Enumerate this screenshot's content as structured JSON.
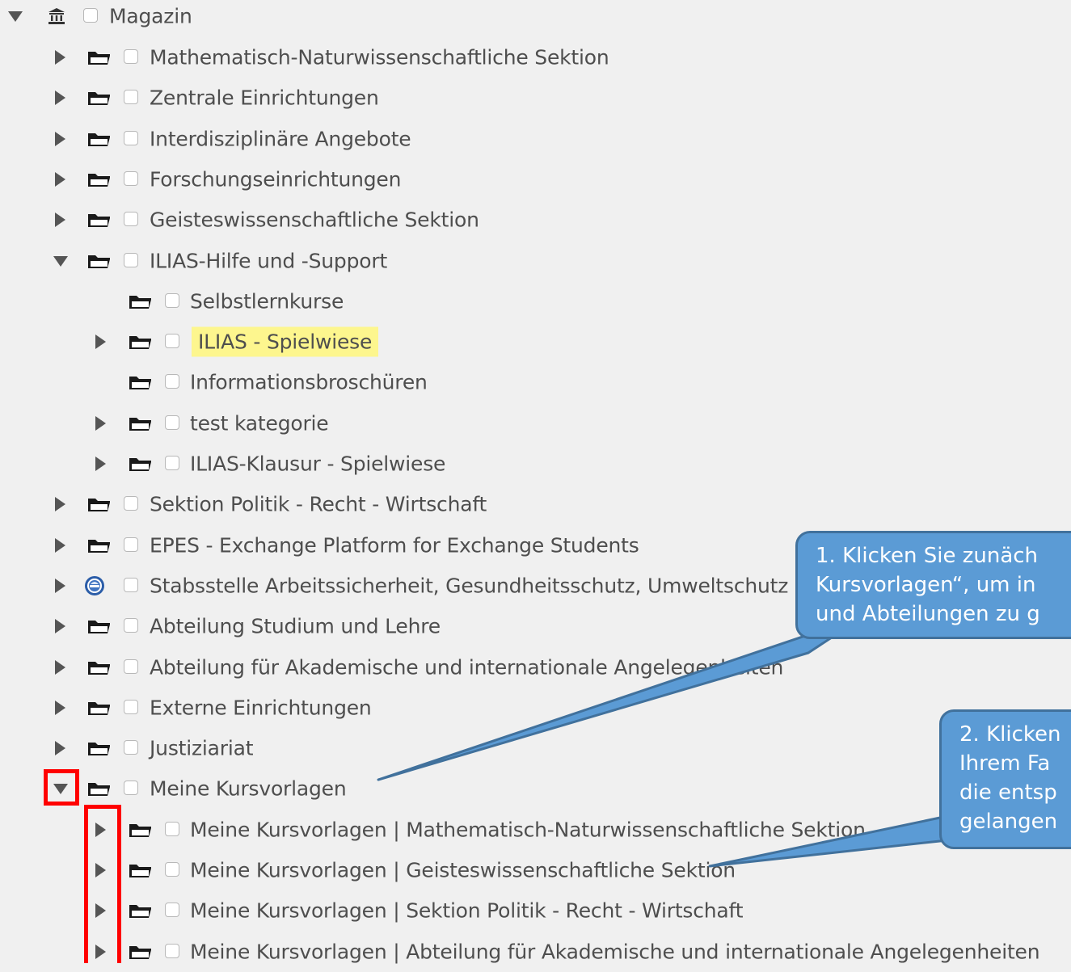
{
  "root": {
    "label": "Magazin",
    "icon": "bank-icon"
  },
  "tree": [
    {
      "label": "Mathematisch-Naturwissenschaftliche Sektion",
      "toggle": "right",
      "level": 1
    },
    {
      "label": "Zentrale Einrichtungen",
      "toggle": "right",
      "level": 1
    },
    {
      "label": "Interdisziplinäre Angebote",
      "toggle": "right",
      "level": 1
    },
    {
      "label": "Forschungseinrichtungen",
      "toggle": "right",
      "level": 1
    },
    {
      "label": "Geisteswissenschaftliche Sektion",
      "toggle": "right",
      "level": 1
    },
    {
      "label": "ILIAS-Hilfe und -Support",
      "toggle": "down",
      "level": 1
    },
    {
      "label": "Selbstlernkurse",
      "toggle": "none",
      "level": 2
    },
    {
      "label": "ILIAS - Spielwiese",
      "toggle": "right",
      "level": 2,
      "highlighted": true
    },
    {
      "label": "Informationsbroschüren",
      "toggle": "none",
      "level": 2
    },
    {
      "label": "test kategorie",
      "toggle": "right",
      "level": 2
    },
    {
      "label": "ILIAS-Klausur - Spielwiese",
      "toggle": "right",
      "level": 2
    },
    {
      "label": "Sektion Politik - Recht - Wirtschaft",
      "toggle": "right",
      "level": 1
    },
    {
      "label": "EPES - Exchange Platform for Exchange Students",
      "toggle": "right",
      "level": 1
    },
    {
      "label": "Stabsstelle Arbeitssicherheit, Gesundheitsschutz, Umweltschutz",
      "toggle": "right",
      "level": 1,
      "icon": "safety-badge-icon"
    },
    {
      "label": "Abteilung Studium und Lehre",
      "toggle": "right",
      "level": 1
    },
    {
      "label": "Abteilung für Akademische und internationale Angelegenheiten",
      "toggle": "right",
      "level": 1
    },
    {
      "label": "Externe Einrichtungen",
      "toggle": "right",
      "level": 1
    },
    {
      "label": "Justiziariat",
      "toggle": "right",
      "level": 1
    },
    {
      "label": "Meine Kursvorlagen",
      "toggle": "down",
      "level": 1
    },
    {
      "label": "Meine Kursvorlagen | Mathematisch-Naturwissenschaftliche Sektion",
      "toggle": "right",
      "level": 2
    },
    {
      "label": "Meine Kursvorlagen | Geisteswissenschaftliche Sektion",
      "toggle": "right",
      "level": 2
    },
    {
      "label": "Meine Kursvorlagen | Sektion Politik - Recht - Wirtschaft",
      "toggle": "right",
      "level": 2
    },
    {
      "label": "Meine Kursvorlagen | Abteilung für Akademische und internationale Angelegenheiten",
      "toggle": "right",
      "level": 2
    }
  ],
  "callouts": {
    "first": [
      "1. Klicken Sie zunäch",
      "Kursvorlagen“, um in",
      "und Abteilungen zu g"
    ],
    "second": [
      "2. Klicken",
      "Ihrem Fa",
      "die entsp",
      "gelangen"
    ]
  },
  "colors": {
    "callout_fill": "#5b9bd5",
    "callout_border": "#41719c",
    "highlight": "#fdf68e",
    "marker": "#ff0000"
  }
}
